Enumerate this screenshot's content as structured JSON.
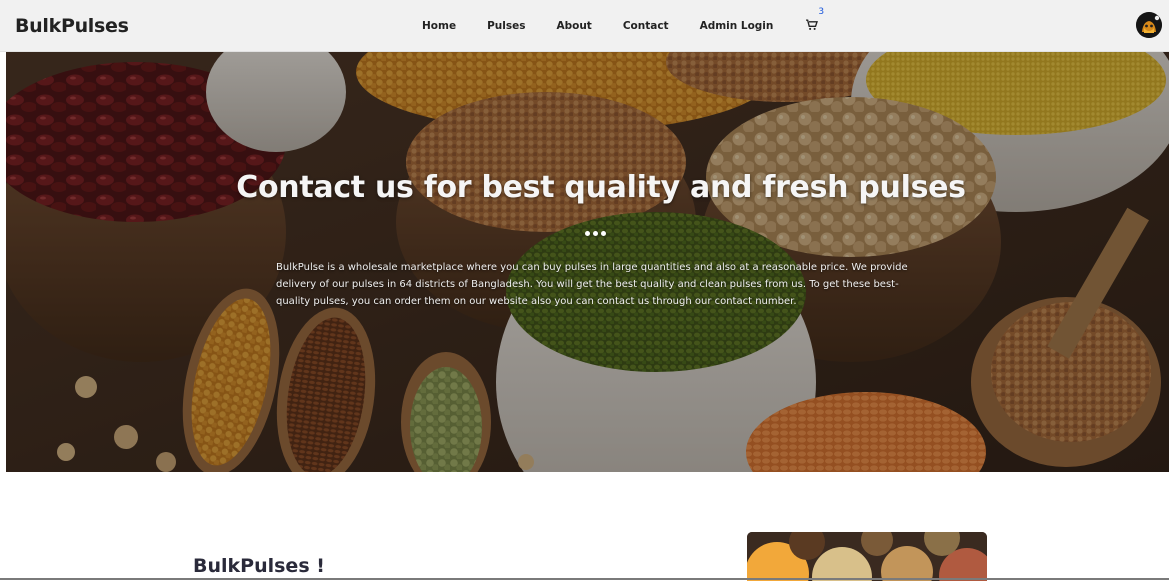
{
  "navbar": {
    "brand": "BulkPulses",
    "links": [
      "Home",
      "Pulses",
      "About",
      "Contact",
      "Admin Login"
    ],
    "cart_count": "3"
  },
  "hero": {
    "title": "Contact us for best quality and fresh pulses",
    "description": "BulkPulse is a wholesale marketplace where you can buy pulses in large quantities and also at a reasonable price. We provide delivery of our pulses in 64 districts of Bangladesh. You will get the best quality and clean pulses from us. To get these best-quality pulses, you can order them on our website also you can contact us through our contact number."
  },
  "about": {
    "title": "BulkPulses !"
  },
  "icons": {
    "cart": "shopping-cart-icon",
    "avatar": "user-avatar"
  }
}
